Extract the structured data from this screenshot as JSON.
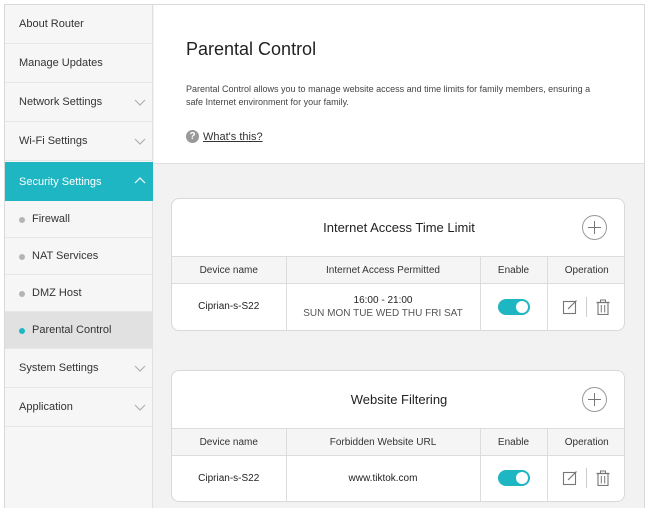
{
  "sidebar": {
    "items": [
      {
        "label": "About Router"
      },
      {
        "label": "Manage Updates"
      },
      {
        "label": "Network Settings"
      },
      {
        "label": "Wi-Fi Settings"
      },
      {
        "label": "Security Settings"
      },
      {
        "label": "System Settings"
      },
      {
        "label": "Application"
      }
    ],
    "security_sub": [
      {
        "label": "Firewall"
      },
      {
        "label": "NAT Services"
      },
      {
        "label": "DMZ Host"
      },
      {
        "label": "Parental Control"
      }
    ],
    "active_item": "Security Settings",
    "active_sub": "Parental Control"
  },
  "header": {
    "title": "Parental Control",
    "description": "Parental Control allows you to manage website access and time limits for family members, ensuring a safe Internet environment for your family.",
    "help_icon": "question-circle-icon",
    "help_label": "What's this?"
  },
  "time_limit": {
    "title": "Internet Access Time Limit",
    "columns": [
      "Device name",
      "Internet Access Permitted",
      "Enable",
      "Operation"
    ],
    "rows": [
      {
        "device": "Ciprian-s-S22",
        "time": "16:00 - 21:00",
        "days": "SUN MON TUE WED THU FRI SAT",
        "enabled": true
      }
    ]
  },
  "website_filtering": {
    "title": "Website Filtering",
    "columns": [
      "Device name",
      "Forbidden Website URL",
      "Enable",
      "Operation"
    ],
    "rows": [
      {
        "device": "Ciprian-s-S22",
        "url": "www.tiktok.com",
        "enabled": true
      }
    ]
  },
  "colors": {
    "accent": "#1fb6c4",
    "sidebar_bg": "#f6f6f6",
    "content_bg": "#f2f2f2"
  }
}
